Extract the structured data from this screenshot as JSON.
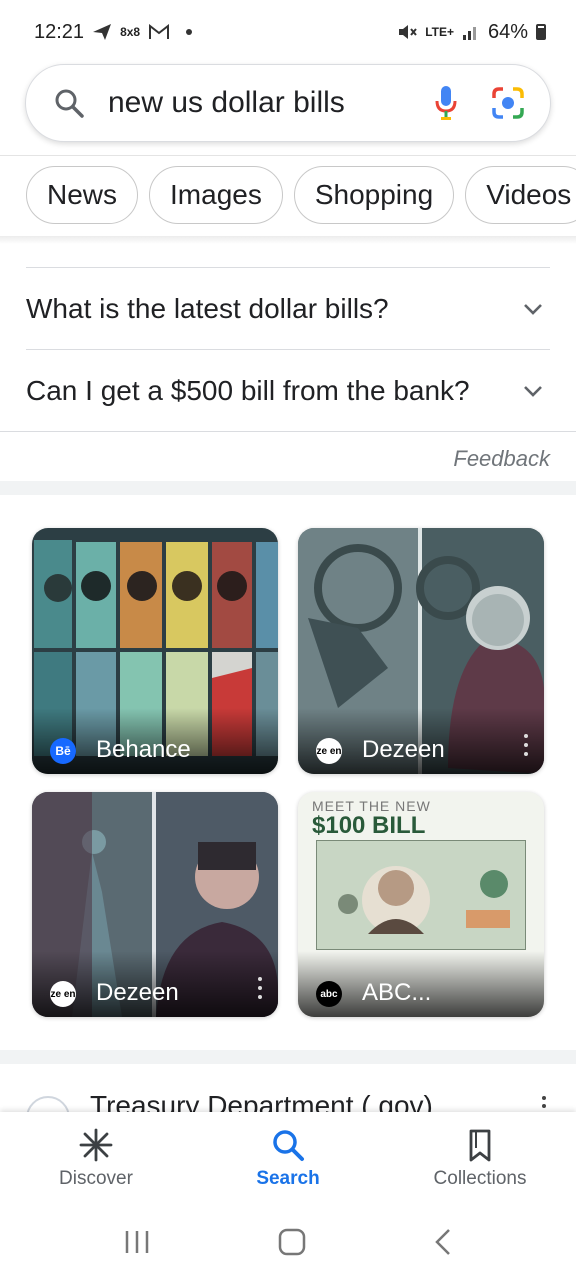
{
  "status_bar": {
    "time": "12:21",
    "notif_text": "8x8",
    "network": "LTE+",
    "battery": "64%"
  },
  "search": {
    "query": "new us dollar bills"
  },
  "chips": [
    {
      "label": "News"
    },
    {
      "label": "Images"
    },
    {
      "label": "Shopping"
    },
    {
      "label": "Videos"
    }
  ],
  "people_also_ask": {
    "questions": [
      {
        "text": "What is the latest dollar bills?"
      },
      {
        "text": "Can I get a $500 bill from the bank?"
      }
    ],
    "feedback": "Feedback"
  },
  "images": [
    {
      "source": "Behance",
      "badge": "Bē",
      "badge_color": "#1769ff"
    },
    {
      "source": "Dezeen",
      "badge": "ze en",
      "badge_color": "#ffffff"
    },
    {
      "source": "Dezeen",
      "badge": "ze en",
      "badge_color": "#ffffff"
    },
    {
      "source": "ABC...",
      "badge": "abc",
      "badge_color": "#ffffff",
      "caption_line1": "MEET THE NEW",
      "caption_line2": "$100 BILL"
    }
  ],
  "result": {
    "title": "Treasury Department (.gov)"
  },
  "bottom_nav": {
    "items": [
      {
        "label": "Discover"
      },
      {
        "label": "Search"
      },
      {
        "label": "Collections"
      }
    ],
    "active": "Search"
  }
}
